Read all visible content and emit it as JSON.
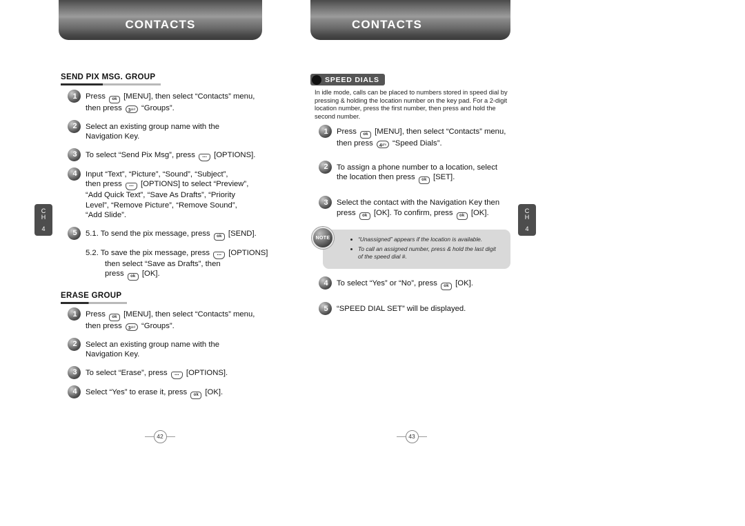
{
  "chapter_tab": {
    "line1": "C",
    "line2": "H",
    "number": "4"
  },
  "left_page": {
    "banner_title": "CONTACTS",
    "page_number": "42",
    "sections": [
      {
        "heading": "SEND PIX MSG. GROUP",
        "steps": [
          {
            "num": "1",
            "lines": [
              "Press [ok] [MENU], then select “Contacts” menu,",
              "then press [3] “Groups”."
            ]
          },
          {
            "num": "2",
            "lines": [
              "Select an existing group name with the",
              "Navigation Key."
            ]
          },
          {
            "num": "3",
            "lines": [
              "To select “Send Pix Msg”, press [options] [OPTIONS]."
            ]
          },
          {
            "num": "4",
            "lines": [
              "Input “Text”, “Picture”, “Sound”, “Subject”,",
              "then press [options] [OPTIONS] to select “Preview”,",
              "“Add Quick Text”, “Save As Drafts”, “Priority",
              "Level”, “Remove Picture”, “Remove Sound”,",
              "“Add Slide”."
            ]
          },
          {
            "num": "5",
            "lines": [
              "5.1. To send the pix message, press [ok] [SEND]."
            ]
          }
        ],
        "substep": [
          "5.2. To save the pix message, press [options] [OPTIONS]",
          "then select “Save as Drafts”, then",
          "press [ok] [OK]."
        ]
      },
      {
        "heading": "ERASE GROUP",
        "steps": [
          {
            "num": "1",
            "lines": [
              "Press [ok] [MENU], then select “Contacts” menu,",
              "then press [3] “Groups”."
            ]
          },
          {
            "num": "2",
            "lines": [
              "Select an existing group name with the",
              "Navigation Key."
            ]
          },
          {
            "num": "3",
            "lines": [
              "To select “Erase”, press [options] [OPTIONS]."
            ]
          },
          {
            "num": "4",
            "lines": [
              "Select “Yes” to erase it, press [ok] [OK]."
            ]
          }
        ]
      }
    ]
  },
  "right_page": {
    "banner_title": "CONTACTS",
    "page_number": "43",
    "badge_label": "SPEED DIALS",
    "intro": "In idle mode, calls can be placed to numbers stored in speed dial by pressing & holding the location number on the key pad. For a 2-digit location number, press the first number, then press and hold the second number.",
    "steps": [
      {
        "num": "1",
        "lines": [
          "Press [ok] [MENU], then select “Contacts” menu,",
          "then press [4] “Speed Dials”."
        ]
      },
      {
        "num": "2",
        "lines": [
          "To assign a phone number to a location, select",
          "the location then press [ok] [SET]."
        ]
      },
      {
        "num": "3",
        "lines": [
          "Select the contact with the Navigation Key then",
          "press [ok] [OK]. To confirm, press [ok] [OK]."
        ]
      }
    ],
    "note": {
      "badge_text": "NOTE",
      "items": [
        "“Unassigned” appears if the location is available.",
        "To call an assigned number, press & hold the last digit of the speed dial #."
      ]
    },
    "steps_after_note": [
      {
        "num": "4",
        "lines": [
          "To select “Yes” or “No”, press [ok] [OK]."
        ]
      },
      {
        "num": "5",
        "lines": [
          "“SPEED DIAL SET” will be displayed."
        ]
      }
    ]
  },
  "keys": {
    "ok": "ok",
    "num3": "3",
    "num4": "4",
    "options": "···"
  }
}
